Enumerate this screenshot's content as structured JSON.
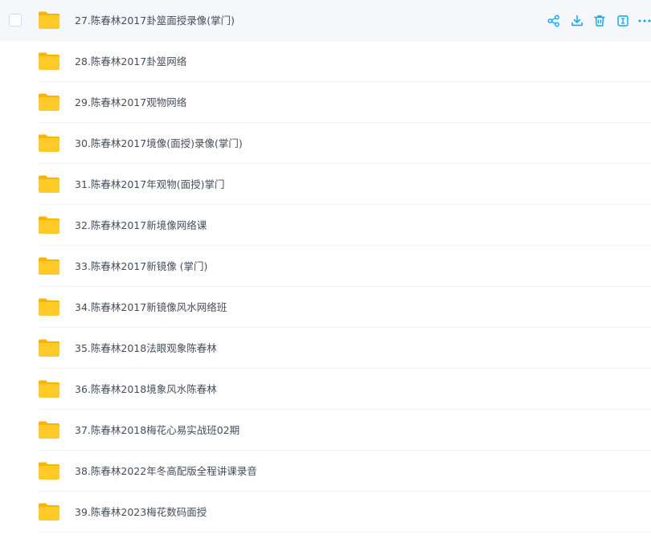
{
  "files": [
    {
      "name": "27.陈春林2017卦筮面授录像(掌门)",
      "hover": true
    },
    {
      "name": "28.陈春林2017卦筮网络"
    },
    {
      "name": "29.陈春林2017观物网络"
    },
    {
      "name": "30.陈春林2017境像(面授)录像(掌门)"
    },
    {
      "name": "31.陈春林2017年观物(面授)掌门"
    },
    {
      "name": "32.陈春林2017新境像网络课"
    },
    {
      "name": "33.陈春林2017新镜像 (掌门)"
    },
    {
      "name": "34.陈春林2017新镜像风水网络班"
    },
    {
      "name": "35.陈春林2018法眼观象陈春林"
    },
    {
      "name": "36.陈春林2018境象风水陈春林"
    },
    {
      "name": "37.陈春林2018梅花心易实战班02期"
    },
    {
      "name": "38.陈春林2022年冬高配版全程讲课录音"
    },
    {
      "name": "39.陈春林2023梅花数码面授"
    }
  ],
  "row_actions": [
    "share-icon",
    "download-icon",
    "delete-icon",
    "rename-icon",
    "more-icon"
  ],
  "colors": {
    "accent": "#06a7ff",
    "folder_body": "#ffca28",
    "folder_back": "#f7b500",
    "hover_bg": "#f5f7fb",
    "text": "#454d5a"
  }
}
